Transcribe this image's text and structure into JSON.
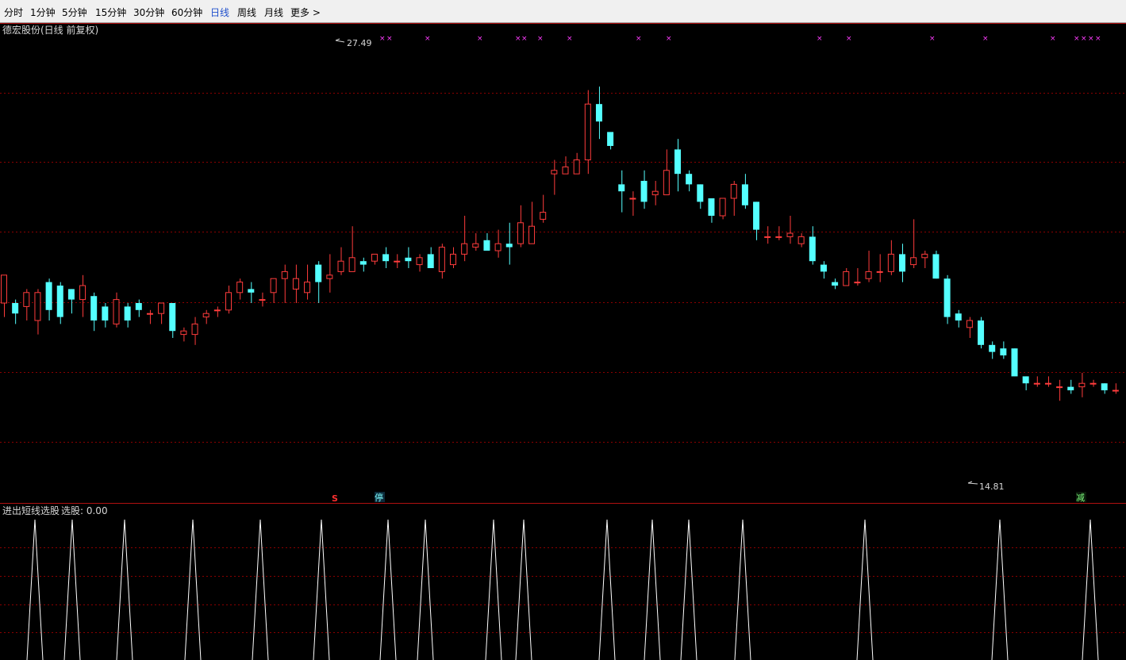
{
  "toolbar": {
    "tabs": [
      {
        "label": "分时",
        "active": false
      },
      {
        "label": "1分钟",
        "active": false
      },
      {
        "label": "5分钟",
        "active": false
      },
      {
        "label": "15分钟",
        "active": false
      },
      {
        "label": "30分钟",
        "active": false
      },
      {
        "label": "60分钟",
        "active": false
      },
      {
        "label": "日线",
        "active": true
      },
      {
        "label": "周线",
        "active": false
      },
      {
        "label": "月线",
        "active": false
      },
      {
        "label": "更多 >",
        "active": false
      }
    ]
  },
  "main_panel": {
    "title": "德宏股份(日线 前复权)",
    "high_label": "27.49",
    "low_label": "14.81",
    "markers": [
      {
        "text": "S",
        "color": "#ff3030"
      },
      {
        "text": "停",
        "color": "#0b2a3a"
      },
      {
        "text": "减",
        "color": "#0a1a0a"
      }
    ]
  },
  "sub_panel": {
    "title": "进出短线选股",
    "value_label": "选股: 0.00"
  },
  "colors": {
    "up": "#ff3c3c",
    "down": "#54ffff",
    "grid": "#8b0000",
    "border": "#b01010",
    "cross_marker": "#ff3cff",
    "indicator": "#ffffff"
  },
  "chart_data": {
    "type": "candlestick",
    "price_range": [
      14.81,
      27.49
    ],
    "candles": [
      [
        19.9,
        20.7,
        19.5,
        20.5
      ],
      [
        19.9,
        19.6,
        19.3,
        20.0
      ],
      [
        19.8,
        20.2,
        19.4,
        20.3
      ],
      [
        19.4,
        20.2,
        19.0,
        20.3
      ],
      [
        20.5,
        19.7,
        19.4,
        20.6
      ],
      [
        20.4,
        19.5,
        19.3,
        20.5
      ],
      [
        20.3,
        20.0,
        19.6,
        20.3
      ],
      [
        20.0,
        20.4,
        19.5,
        20.7
      ],
      [
        20.1,
        19.4,
        19.1,
        20.2
      ],
      [
        19.8,
        19.4,
        19.2,
        19.9
      ],
      [
        19.3,
        20.0,
        19.2,
        20.2
      ],
      [
        19.8,
        19.4,
        19.2,
        19.9
      ],
      [
        19.9,
        19.7,
        19.5,
        20.0
      ],
      [
        19.6,
        19.6,
        19.3,
        19.7
      ],
      [
        19.6,
        19.9,
        19.3,
        19.9
      ],
      [
        19.9,
        19.1,
        18.9,
        19.9
      ],
      [
        19.0,
        19.1,
        18.8,
        19.2
      ],
      [
        19.0,
        19.3,
        18.7,
        19.5
      ],
      [
        19.5,
        19.6,
        19.3,
        19.7
      ],
      [
        19.7,
        19.7,
        19.5,
        19.8
      ],
      [
        19.7,
        20.2,
        19.6,
        20.4
      ],
      [
        20.2,
        20.5,
        20.0,
        20.6
      ],
      [
        20.3,
        20.2,
        19.9,
        20.5
      ],
      [
        20.0,
        20.0,
        19.8,
        20.2
      ],
      [
        20.2,
        20.6,
        19.9,
        20.6
      ],
      [
        20.6,
        20.8,
        19.9,
        21.0
      ],
      [
        20.3,
        20.6,
        19.9,
        21.0
      ],
      [
        20.2,
        20.5,
        20.0,
        21.0
      ],
      [
        21.0,
        20.5,
        19.9,
        21.1
      ],
      [
        20.6,
        20.7,
        20.2,
        21.3
      ],
      [
        20.8,
        21.1,
        20.7,
        21.5
      ],
      [
        20.8,
        21.2,
        20.9,
        22.1
      ],
      [
        21.1,
        21.0,
        20.8,
        21.2
      ],
      [
        21.1,
        21.3,
        21.0,
        21.3
      ],
      [
        21.3,
        21.1,
        20.9,
        21.5
      ],
      [
        21.1,
        21.1,
        20.9,
        21.3
      ],
      [
        21.2,
        21.1,
        20.9,
        21.5
      ],
      [
        21.0,
        21.2,
        20.8,
        21.3
      ],
      [
        21.3,
        20.9,
        20.9,
        21.5
      ],
      [
        20.8,
        21.5,
        20.6,
        21.6
      ],
      [
        21.0,
        21.3,
        20.9,
        21.5
      ],
      [
        21.3,
        21.6,
        21.1,
        22.4
      ],
      [
        21.5,
        21.6,
        21.4,
        21.9
      ],
      [
        21.7,
        21.4,
        21.5,
        21.9
      ],
      [
        21.4,
        21.6,
        21.2,
        22.0
      ],
      [
        21.6,
        21.5,
        21.0,
        22.2
      ],
      [
        21.6,
        22.2,
        21.5,
        22.7
      ],
      [
        21.6,
        22.1,
        21.6,
        22.8
      ],
      [
        22.3,
        22.5,
        22.2,
        23.0
      ],
      [
        23.6,
        23.7,
        23.0,
        24.0
      ],
      [
        23.6,
        23.8,
        23.6,
        24.1
      ],
      [
        23.6,
        24.0,
        23.6,
        24.2
      ],
      [
        24.0,
        25.6,
        23.6,
        26.0
      ],
      [
        25.6,
        25.1,
        24.6,
        26.1
      ],
      [
        24.8,
        24.4,
        24.3,
        24.6
      ],
      [
        23.3,
        23.1,
        22.5,
        23.7
      ],
      [
        22.9,
        22.9,
        22.4,
        23.1
      ],
      [
        23.4,
        22.8,
        22.6,
        23.7
      ],
      [
        23.0,
        23.1,
        22.7,
        23.4
      ],
      [
        23.0,
        23.7,
        23.0,
        24.3
      ],
      [
        24.3,
        23.6,
        23.1,
        24.6
      ],
      [
        23.6,
        23.3,
        23.1,
        23.7
      ],
      [
        23.3,
        22.8,
        22.6,
        23.3
      ],
      [
        22.9,
        22.4,
        22.2,
        22.9
      ],
      [
        22.4,
        22.9,
        22.3,
        22.9
      ],
      [
        22.9,
        23.3,
        22.4,
        23.4
      ],
      [
        23.3,
        22.7,
        22.6,
        23.6
      ],
      [
        22.8,
        22.0,
        21.7,
        22.8
      ],
      [
        21.8,
        21.8,
        21.6,
        22.1
      ],
      [
        21.8,
        21.8,
        21.7,
        22.1
      ],
      [
        21.8,
        21.9,
        21.6,
        22.4
      ],
      [
        21.6,
        21.8,
        21.5,
        21.9
      ],
      [
        21.8,
        21.1,
        21.0,
        22.1
      ],
      [
        21.0,
        20.8,
        20.6,
        21.1
      ],
      [
        20.5,
        20.4,
        20.3,
        20.6
      ],
      [
        20.4,
        20.8,
        20.5,
        20.9
      ],
      [
        20.5,
        20.5,
        20.4,
        20.9
      ],
      [
        20.6,
        20.8,
        20.5,
        21.4
      ],
      [
        20.8,
        20.8,
        20.5,
        21.3
      ],
      [
        20.8,
        21.3,
        20.7,
        21.7
      ],
      [
        21.3,
        20.8,
        20.5,
        21.6
      ],
      [
        21.0,
        21.2,
        20.9,
        22.3
      ],
      [
        21.2,
        21.3,
        20.9,
        21.4
      ],
      [
        21.3,
        20.6,
        20.6,
        21.4
      ],
      [
        20.6,
        19.5,
        19.3,
        20.7
      ],
      [
        19.6,
        19.4,
        19.2,
        19.7
      ],
      [
        19.2,
        19.4,
        18.9,
        19.5
      ],
      [
        19.4,
        18.7,
        18.6,
        19.5
      ],
      [
        18.7,
        18.5,
        18.3,
        18.8
      ],
      [
        18.6,
        18.4,
        18.3,
        18.8
      ],
      [
        18.6,
        17.8,
        17.8,
        18.6
      ],
      [
        17.8,
        17.6,
        17.4,
        17.8
      ],
      [
        17.6,
        17.6,
        17.5,
        17.8
      ],
      [
        17.6,
        17.6,
        17.5,
        17.8
      ],
      [
        17.5,
        17.5,
        17.1,
        17.7
      ],
      [
        17.5,
        17.4,
        17.3,
        17.7
      ],
      [
        17.5,
        17.6,
        17.2,
        17.9
      ],
      [
        17.6,
        17.6,
        17.5,
        17.7
      ],
      [
        17.6,
        17.4,
        17.3,
        17.6
      ],
      [
        17.4,
        17.4,
        17.3,
        17.6
      ]
    ]
  }
}
